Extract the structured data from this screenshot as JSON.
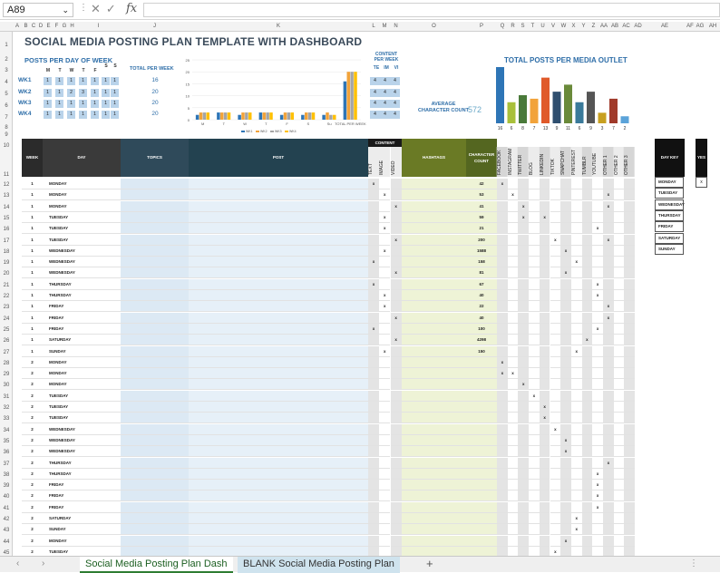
{
  "namebox": "A89",
  "formula_glyph": "fx",
  "columns": [
    "A",
    "B",
    "C",
    "D",
    "E",
    "F",
    "G",
    "H",
    "I",
    "J",
    "K",
    "L",
    "M",
    "N",
    "O",
    "P",
    "Q",
    "R",
    "S",
    "T",
    "U",
    "V",
    "W",
    "X",
    "Y",
    "Z",
    "AA",
    "AB",
    "AC",
    "AD",
    "AE",
    "AF",
    "AG",
    "AH"
  ],
  "title": "SOCIAL MEDIA POSTING PLAN TEMPLATE WITH DASHBOARD",
  "posts_per_day": {
    "heading": "POSTS PER DAY OF WEEK",
    "days": [
      "M",
      "T",
      "W",
      "T",
      "F",
      "S",
      "S"
    ],
    "weeks": [
      "WK1",
      "WK2",
      "WK3",
      "WK4"
    ],
    "cells": [
      [
        "1",
        "1",
        "1",
        "1",
        "1",
        "1",
        "1"
      ],
      [
        "1",
        "1",
        "2",
        "3",
        "1",
        "1",
        "1"
      ],
      [
        "1",
        "1",
        "1",
        "1",
        "1",
        "1",
        "1"
      ],
      [
        "1",
        "1",
        "1",
        "1",
        "1",
        "1",
        "1"
      ]
    ]
  },
  "total_per_week": {
    "heading": "TOTAL PER WEEK",
    "values": [
      "16",
      "20",
      "20",
      "20"
    ]
  },
  "content_per_week": {
    "heading": "CONTENT PER WEEK",
    "cols": [
      "TE",
      "IM",
      "VI"
    ],
    "rows": [
      [
        "4",
        "4",
        "4"
      ],
      [
        "4",
        "4",
        "4"
      ],
      [
        "4",
        "4",
        "4"
      ],
      [
        "4",
        "4",
        "4"
      ]
    ]
  },
  "avg_char": {
    "label": "AVERAGE CHARACTER COUNT",
    "value": "572"
  },
  "chart_data": [
    {
      "type": "bar",
      "title": "",
      "categories": [
        "M",
        "T",
        "W",
        "T",
        "F",
        "S",
        "Su",
        "TOTAL PER WEEK"
      ],
      "series": [
        {
          "name": "WK1",
          "values": [
            2,
            3,
            2,
            3,
            2,
            2,
            2,
            16
          ]
        },
        {
          "name": "WK2",
          "values": [
            3,
            3,
            3,
            3,
            3,
            3,
            3,
            20
          ]
        },
        {
          "name": "WK3",
          "values": [
            3,
            3,
            3,
            3,
            3,
            3,
            2,
            20
          ]
        },
        {
          "name": "WK4",
          "values": [
            3,
            3,
            3,
            3,
            3,
            3,
            2,
            20
          ]
        }
      ],
      "ylim": [
        0,
        25
      ],
      "yticks": [
        "25",
        "20",
        "15",
        "10",
        "5",
        "0"
      ],
      "colors": [
        "#2e75b6",
        "#f2a33a",
        "#a5a5a5",
        "#ffc000"
      ]
    },
    {
      "type": "bar",
      "title": "TOTAL POSTS PER MEDIA OUTLET",
      "values": [
        16,
        6,
        8,
        7,
        13,
        9,
        11,
        6,
        9,
        3,
        7,
        2
      ],
      "colors": [
        "#2e75b6",
        "#a9c03a",
        "#4a7a3a",
        "#f2a33a",
        "#e05a2a",
        "#2f4f6f",
        "#6a8a3a",
        "#3a7a9a",
        "#555555",
        "#c8a020",
        "#a03a2a",
        "#5ba3d9"
      ]
    }
  ],
  "table": {
    "headers": {
      "week": "WEEK",
      "day": "DAY",
      "topics": "TOPICS",
      "post": "POST",
      "content": "CONTENT",
      "hashtags": "HASHTAGS",
      "chars": "CHARACTER COUNT",
      "daykey": "DAY KEY",
      "yes": "YES"
    },
    "content_types": [
      "TEXT",
      "IMAGE",
      "VIDEO"
    ],
    "outlets": [
      "FACEBOOK",
      "INSTAGRAM",
      "TWITTER",
      "BLOG",
      "LINKEDIN",
      "TIKTOK",
      "SNAPCHAT",
      "PINTEREST",
      "TUMBLR",
      "YOUTUBE",
      "OTHER 1",
      "OTHER 2",
      "OTHER 3"
    ],
    "rows": [
      {
        "week": "1",
        "day": "MONDAY",
        "c": 1,
        "chars": "42",
        "o": [
          1
        ]
      },
      {
        "week": "1",
        "day": "MONDAY",
        "c": 2,
        "chars": "53",
        "o": [
          2,
          11
        ]
      },
      {
        "week": "1",
        "day": "MONDAY",
        "c": 3,
        "chars": "41",
        "o": [
          3,
          11
        ]
      },
      {
        "week": "1",
        "day": "TUESDAY",
        "c": 2,
        "chars": "59",
        "o": [
          3,
          5
        ]
      },
      {
        "week": "1",
        "day": "TUESDAY",
        "c": 2,
        "chars": "21",
        "o": [
          10
        ]
      },
      {
        "week": "1",
        "day": "TUESDAY",
        "c": 3,
        "chars": "200",
        "o": [
          6,
          11
        ]
      },
      {
        "week": "1",
        "day": "WEDNESDAY",
        "c": 2,
        "chars": "1588",
        "o": [
          7
        ]
      },
      {
        "week": "1",
        "day": "WEDNESDAY",
        "c": 1,
        "chars": "158",
        "o": [
          8
        ]
      },
      {
        "week": "1",
        "day": "WEDNESDAY",
        "c": 3,
        "chars": "81",
        "o": [
          7
        ]
      },
      {
        "week": "1",
        "day": "THURSDAY",
        "c": 1,
        "chars": "67",
        "o": [
          10
        ]
      },
      {
        "week": "1",
        "day": "THURSDAY",
        "c": 2,
        "chars": "40",
        "o": [
          10
        ]
      },
      {
        "week": "1",
        "day": "FRIDAY",
        "c": 2,
        "chars": "22",
        "o": [
          11
        ]
      },
      {
        "week": "1",
        "day": "FRIDAY",
        "c": 3,
        "chars": "40",
        "o": [
          11
        ]
      },
      {
        "week": "1",
        "day": "FRIDAY",
        "c": 1,
        "chars": "100",
        "o": [
          10
        ]
      },
      {
        "week": "1",
        "day": "SATURDAY",
        "c": 3,
        "chars": "4298",
        "o": [
          9
        ]
      },
      {
        "week": "1",
        "day": "SUNDAY",
        "c": 2,
        "chars": "150",
        "o": [
          8
        ]
      },
      {
        "week": "2",
        "day": "MONDAY",
        "c": 0,
        "chars": "",
        "o": [
          1
        ]
      },
      {
        "week": "2",
        "day": "MONDAY",
        "c": 0,
        "chars": "",
        "o": [
          1,
          2
        ]
      },
      {
        "week": "2",
        "day": "MONDAY",
        "c": 0,
        "chars": "",
        "o": [
          3
        ]
      },
      {
        "week": "2",
        "day": "TUESDAY",
        "c": 0,
        "chars": "",
        "o": [
          4
        ]
      },
      {
        "week": "2",
        "day": "TUESDAY",
        "c": 0,
        "chars": "",
        "o": [
          5
        ]
      },
      {
        "week": "2",
        "day": "TUESDAY",
        "c": 0,
        "chars": "",
        "o": [
          5
        ]
      },
      {
        "week": "2",
        "day": "WEDNESDAY",
        "c": 0,
        "chars": "",
        "o": [
          6
        ]
      },
      {
        "week": "2",
        "day": "WEDNESDAY",
        "c": 0,
        "chars": "",
        "o": [
          7
        ]
      },
      {
        "week": "2",
        "day": "WEDNESDAY",
        "c": 0,
        "chars": "",
        "o": [
          7
        ]
      },
      {
        "week": "2",
        "day": "THURSDAY",
        "c": 0,
        "chars": "",
        "o": [
          11
        ]
      },
      {
        "week": "2",
        "day": "THURSDAY",
        "c": 0,
        "chars": "",
        "o": [
          10
        ]
      },
      {
        "week": "2",
        "day": "FRIDAY",
        "c": 0,
        "chars": "",
        "o": [
          10
        ]
      },
      {
        "week": "2",
        "day": "FRIDAY",
        "c": 0,
        "chars": "",
        "o": [
          10
        ]
      },
      {
        "week": "2",
        "day": "FRIDAY",
        "c": 0,
        "chars": "",
        "o": [
          10
        ]
      },
      {
        "week": "2",
        "day": "SATURDAY",
        "c": 0,
        "chars": "",
        "o": [
          8
        ]
      },
      {
        "week": "2",
        "day": "SUNDAY",
        "c": 0,
        "chars": "",
        "o": [
          8
        ]
      },
      {
        "week": "2",
        "day": "MONDAY",
        "c": 0,
        "chars": "",
        "o": [
          7
        ]
      },
      {
        "week": "2",
        "day": "TUESDAY",
        "c": 0,
        "chars": "",
        "o": [
          6
        ]
      }
    ]
  },
  "day_key": [
    "MONDAY",
    "TUESDAY",
    "WEDNESDAY",
    "THURSDAY",
    "FRIDAY",
    "SATURDAY",
    "SUNDAY"
  ],
  "tabs": {
    "active": "Social Media Posting Plan Dash",
    "other": "BLANK Social Media Posting Plan",
    "add": "+"
  }
}
